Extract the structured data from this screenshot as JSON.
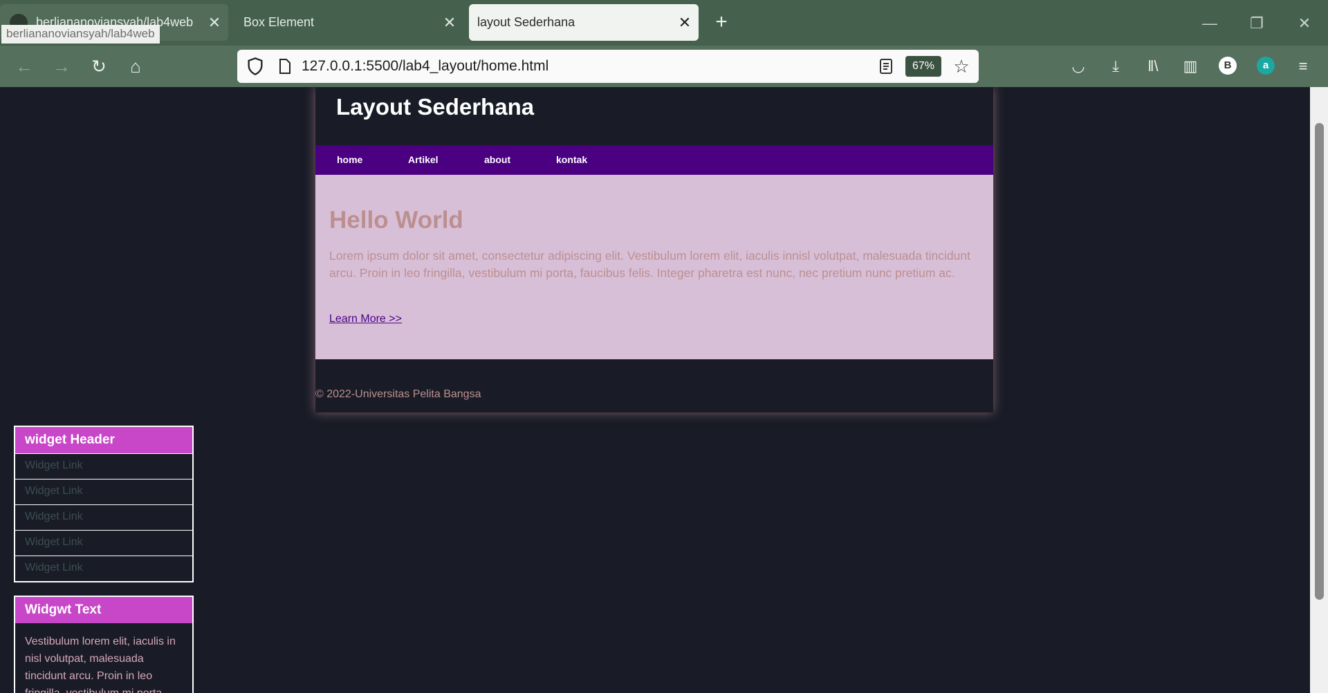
{
  "browser": {
    "tabs": [
      {
        "label": "berliananoviansyah/lab4web",
        "active": false
      },
      {
        "label": "Box Element",
        "active": false
      },
      {
        "label": "layout Sederhana",
        "active": true
      }
    ],
    "tooltip": "berliananoviansyah/lab4web",
    "url": "127.0.0.1:5500/lab4_layout/home.html",
    "zoom": "67%",
    "account_initial": "B",
    "addon_initial": "a"
  },
  "page": {
    "site_title": "Layout Sederhana",
    "nav": [
      "home",
      "Artikel",
      "about",
      "kontak"
    ],
    "hero": {
      "heading": "Hello World",
      "body": "Lorem ipsum dolor sit amet, consectetur adipiscing elit. Vestibulum lorem elit, iaculis innisl volutpat, malesuada tincidunt arcu. Proin in leo fringilla, vestibulum mi porta, faucibus felis. Integer pharetra est nunc, nec pretium nunc pretium ac.",
      "link": "Learn More >>"
    },
    "footer": "© 2022-Universitas Pelita Bangsa",
    "widget_links": {
      "header": "widget Header",
      "links": [
        "Widget Link",
        "Widget Link",
        "Widget Link",
        "Widget Link",
        "Widget Link"
      ]
    },
    "widget_text": {
      "header": "Widgwt Text",
      "body": "Vestibulum lorem elit, iaculis in nisl volutpat, malesuada tincidunt arcu. Proin in leo fringilla, vestibulum mi porta"
    }
  },
  "colors": {
    "chrome_tabbar": "#45604d",
    "chrome_navbar": "#56705e",
    "page_bg": "#191c27",
    "nav_bg": "#4b0082",
    "hero_bg": "#d8bfd8",
    "hero_text": "#bc8f8f",
    "widget_header": "#c846c8"
  }
}
